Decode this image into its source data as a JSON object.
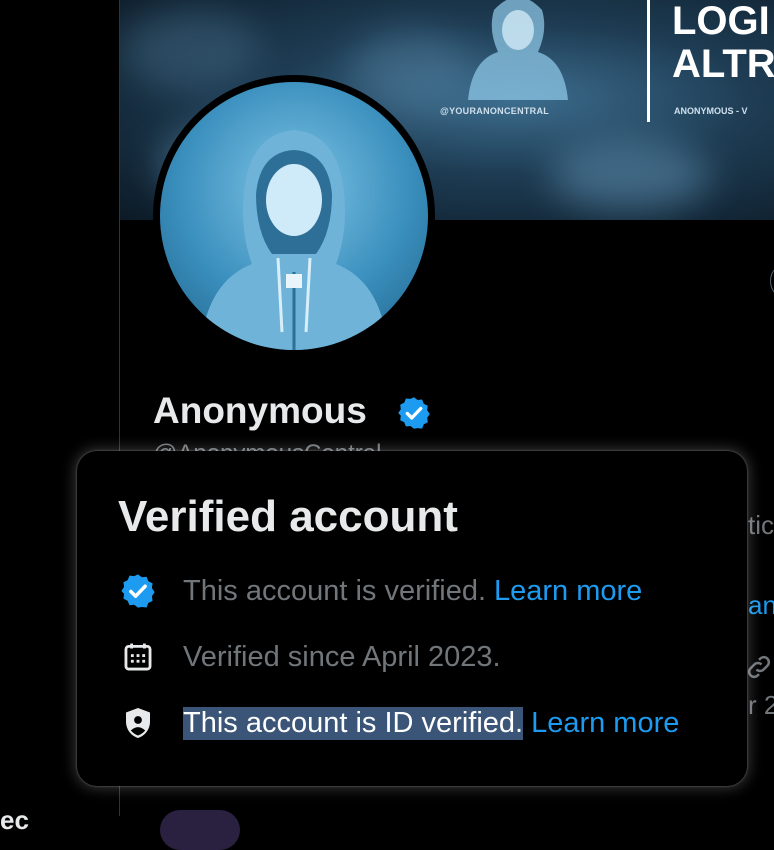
{
  "profile": {
    "display_name": "Anonymous",
    "handle_partial": "@AnonymousCentral",
    "verified_badge_icon": "verified-badge-icon"
  },
  "banner": {
    "handle": "@YOURANONCENTRAL",
    "headline_line1": "LOGI",
    "headline_line2": "ALTR",
    "subline": "ANONYMOUS - V"
  },
  "background_fragments": {
    "right_1": "tic",
    "right_2": "an",
    "right_3": "r 2",
    "left_1": "ec"
  },
  "popover": {
    "title": "Verified account",
    "rows": [
      {
        "icon": "verified-badge-icon",
        "text": "This account is verified.",
        "link": "Learn more"
      },
      {
        "icon": "calendar-icon",
        "text": "Verified since April 2023.",
        "link": ""
      },
      {
        "icon": "id-shield-icon",
        "text": "This account is ID verified.",
        "link": "Learn more",
        "selected": true
      }
    ]
  },
  "colors": {
    "background": "#000000",
    "text_primary": "#e7e9ea",
    "text_secondary": "#71767b",
    "link": "#1d9bf0",
    "selection": "#3b5578"
  }
}
